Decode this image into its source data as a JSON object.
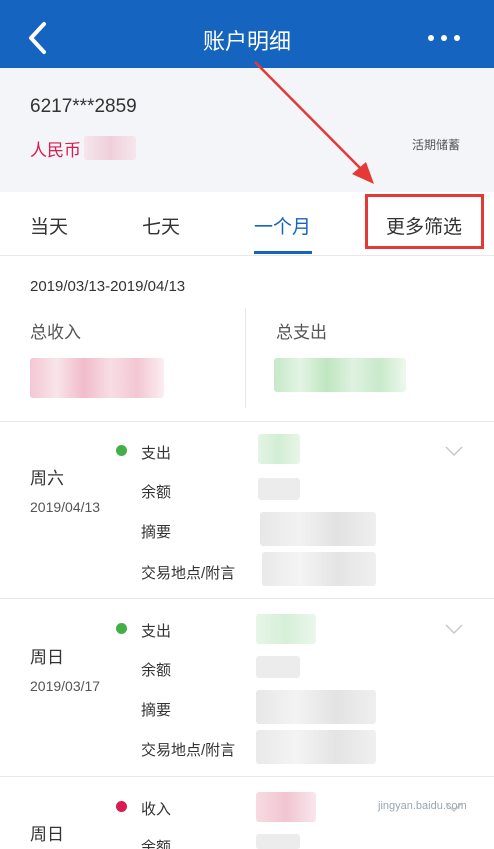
{
  "header": {
    "title": "账户明细",
    "back_icon": "chevron-left-icon",
    "more_icon": "more-dots-icon",
    "background": "#1565c0"
  },
  "account": {
    "number": "6217***2859",
    "currency": "人民币",
    "type": "活期储蓄"
  },
  "tabs": [
    {
      "label": "当天",
      "active": false
    },
    {
      "label": "七天",
      "active": false
    },
    {
      "label": "一个月",
      "active": true
    }
  ],
  "filter": {
    "label": "更多筛选",
    "highlight_color": "#e53935"
  },
  "summary": {
    "date_range": "2019/03/13-2019/04/13",
    "income_label": "总收入",
    "expense_label": "总支出"
  },
  "records": [
    {
      "weekday": "周六",
      "date": "2019/04/13",
      "type": "支出",
      "type_color": "#43b047",
      "fields": [
        "余额",
        "摘要",
        "交易地点/附言"
      ]
    },
    {
      "weekday": "周日",
      "date": "2019/03/17",
      "type": "支出",
      "type_color": "#43b047",
      "fields": [
        "余额",
        "摘要",
        "交易地点/附言"
      ]
    },
    {
      "weekday": "周日",
      "type": "收入",
      "type_color": "#d81b50",
      "fields": [
        "余额"
      ]
    }
  ],
  "watermark": "jingyan.baidu.com"
}
